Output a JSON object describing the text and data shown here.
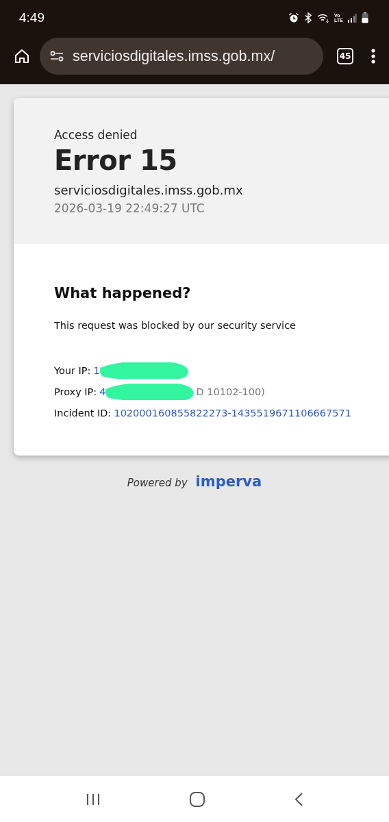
{
  "status_bar": {
    "time": "4:49",
    "network_label": "Vo LTE"
  },
  "browser_toolbar": {
    "url": "serviciosdigitales.imss.gob.mx/",
    "tab_count": "45"
  },
  "error_header": {
    "subtitle": "Access denied",
    "title": "Error 15",
    "domain": "serviciosdigitales.imss.gob.mx",
    "timestamp": "2026-03-19 22:49:27 UTC"
  },
  "details": {
    "heading": "What happened?",
    "message": "This request was blocked by our security service",
    "fields": [
      {
        "label": "Your IP:",
        "value_start": "1",
        "redacted": true
      },
      {
        "label": "Proxy IP:",
        "value_start": "4",
        "redacted": true,
        "value_end": "D 10102-100)"
      },
      {
        "label": "Incident ID:",
        "value_start": "102000160855822273-1435519671106667571",
        "redacted": false
      }
    ]
  },
  "footer": {
    "powered_by": "Powered by",
    "brand": "imperva"
  }
}
